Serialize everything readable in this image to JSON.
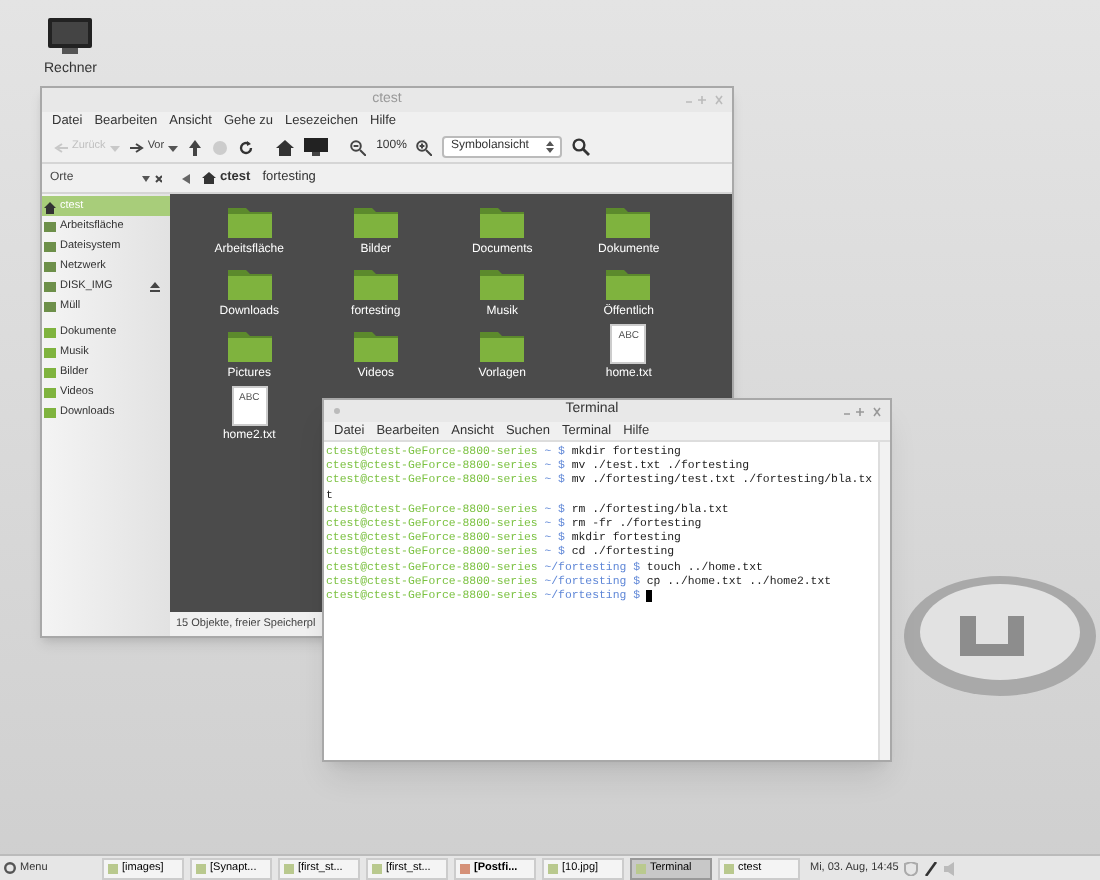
{
  "desktop_icons": [
    {
      "label": "Rechner"
    }
  ],
  "file_manager": {
    "title": "ctest",
    "menu": [
      "Datei",
      "Bearbeiten",
      "Ansicht",
      "Gehe zu",
      "Lesezeichen",
      "Hilfe"
    ],
    "toolbar": {
      "back": {
        "label": "Zurück",
        "disabled": true
      },
      "forward": {
        "label": "Vor",
        "disabled": false
      },
      "zoom": "100%",
      "view_select": "Symbolansicht"
    },
    "sidebar": {
      "header": "Orte",
      "items": [
        {
          "label": "ctest",
          "selected": true,
          "eject": false
        },
        {
          "label": "Arbeitsfläche",
          "selected": false,
          "eject": false
        },
        {
          "label": "Dateisystem",
          "selected": false,
          "eject": false
        },
        {
          "label": "Netzwerk",
          "selected": false,
          "eject": false
        },
        {
          "label": "DISK_IMG",
          "selected": false,
          "eject": true
        },
        {
          "label": "Müll",
          "selected": false,
          "eject": false
        }
      ],
      "bookmarks": [
        {
          "label": "Dokumente"
        },
        {
          "label": "Musik"
        },
        {
          "label": "Bilder"
        },
        {
          "label": "Videos"
        },
        {
          "label": "Downloads"
        }
      ]
    },
    "path": [
      {
        "label": "ctest",
        "selected": true
      },
      {
        "label": "fortesting",
        "selected": false
      }
    ],
    "items": [
      {
        "label": "Arbeitsfläche",
        "kind": "folder"
      },
      {
        "label": "Bilder",
        "kind": "folder"
      },
      {
        "label": "Documents",
        "kind": "folder"
      },
      {
        "label": "Dokumente",
        "kind": "folder"
      },
      {
        "label": "Downloads",
        "kind": "folder"
      },
      {
        "label": "fortesting",
        "kind": "folder"
      },
      {
        "label": "Musik",
        "kind": "folder"
      },
      {
        "label": "Öffentlich",
        "kind": "folder"
      },
      {
        "label": "Pictures",
        "kind": "folder"
      },
      {
        "label": "Videos",
        "kind": "folder"
      },
      {
        "label": "Vorlagen",
        "kind": "folder"
      },
      {
        "label": "home.txt",
        "kind": "text",
        "thumb": "ABC"
      },
      {
        "label": "home2.txt",
        "kind": "text",
        "thumb": "ABC"
      }
    ],
    "status": "15 Objekte, freier Speicherpl"
  },
  "terminal": {
    "title": "Terminal",
    "menu": [
      "Datei",
      "Bearbeiten",
      "Ansicht",
      "Suchen",
      "Terminal",
      "Hilfe"
    ],
    "lines": [
      {
        "kind": "prompt",
        "user": "ctest@ctest-GeForce-8800-series",
        "path": "~",
        "sign": "$",
        "command": "mkdir fortesting"
      },
      {
        "kind": "prompt",
        "user": "ctest@ctest-GeForce-8800-series",
        "path": "~",
        "sign": "$",
        "command": "mv ./test.txt ./fortesting"
      },
      {
        "kind": "prompt",
        "user": "ctest@ctest-GeForce-8800-series",
        "path": "~",
        "sign": "$",
        "command": "mv ./fortesting/test.txt ./fortesting/bla.tx"
      },
      {
        "kind": "output",
        "text": "t"
      },
      {
        "kind": "prompt",
        "user": "ctest@ctest-GeForce-8800-series",
        "path": "~",
        "sign": "$",
        "command": "rm ./fortesting/bla.txt"
      },
      {
        "kind": "prompt",
        "user": "ctest@ctest-GeForce-8800-series",
        "path": "~",
        "sign": "$",
        "command": "rm -fr ./fortesting"
      },
      {
        "kind": "prompt",
        "user": "ctest@ctest-GeForce-8800-series",
        "path": "~",
        "sign": "$",
        "command": "mkdir fortesting"
      },
      {
        "kind": "prompt",
        "user": "ctest@ctest-GeForce-8800-series",
        "path": "~",
        "sign": "$",
        "command": "cd ./fortesting"
      },
      {
        "kind": "prompt",
        "user": "ctest@ctest-GeForce-8800-series",
        "path": "~/fortesting",
        "sign": "$",
        "command": "touch ../home.txt"
      },
      {
        "kind": "prompt",
        "user": "ctest@ctest-GeForce-8800-series",
        "path": "~/fortesting",
        "sign": "$",
        "command": "cp ../home.txt ../home2.txt"
      },
      {
        "kind": "prompt",
        "user": "ctest@ctest-GeForce-8800-series",
        "path": "~/fortesting",
        "sign": "$",
        "cursor": true
      }
    ]
  },
  "taskbar": {
    "menu": "Menu",
    "tasks": [
      {
        "label": "[images]",
        "selected": false,
        "bold": false
      },
      {
        "label": "[Synapt...",
        "selected": false,
        "bold": false
      },
      {
        "label": "[first_st...",
        "selected": false,
        "bold": false
      },
      {
        "label": "[first_st...",
        "selected": false,
        "bold": false
      },
      {
        "label": "[Postfi...",
        "selected": false,
        "bold": true
      },
      {
        "label": "[10.jpg]",
        "selected": false,
        "bold": false
      },
      {
        "label": "Terminal",
        "selected": true,
        "bold": false
      },
      {
        "label": "ctest",
        "selected": false,
        "bold": false
      }
    ],
    "clock": "Mi, 03. Aug, 14:45"
  }
}
